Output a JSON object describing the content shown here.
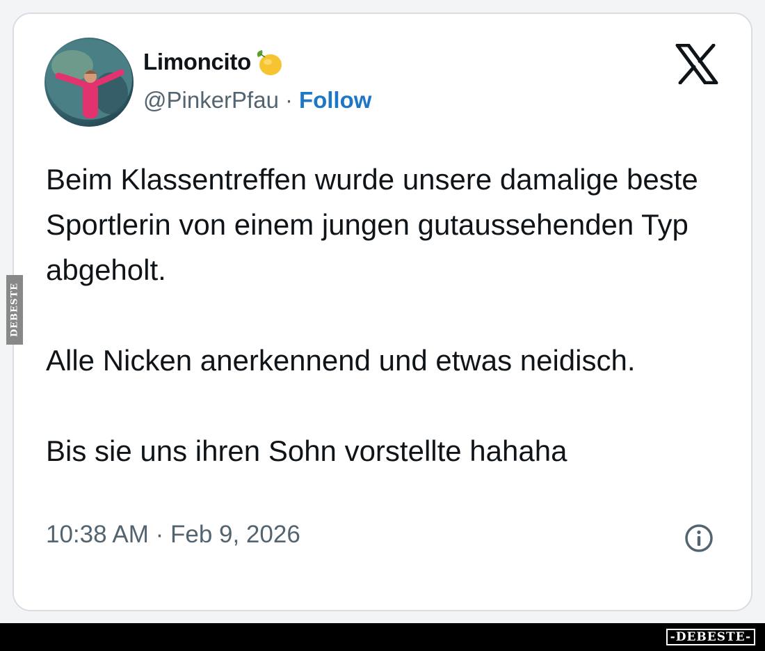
{
  "tweet": {
    "display_name": "Limoncito",
    "name_emoji": "lemon-icon",
    "handle": "@PinkerPfau",
    "separator": "·",
    "follow_label": "Follow",
    "paragraphs": [
      "Beim Klassentreffen wurde unsere damalige beste Sportlerin von einem jungen gutaussehenden Typ abgeholt.",
      "Alle Nicken anerkennend und etwas neidisch.",
      "Bis sie uns ihren Sohn vorstellte hahaha"
    ],
    "timestamp": "10:38 AM · Feb 9, 2026"
  },
  "icons": {
    "platform_logo": "x-logo-icon",
    "info": "info-icon"
  },
  "watermark": {
    "side_text": "DEBESTE",
    "footer_text": "-DEBESTE-"
  },
  "colors": {
    "text_primary": "#0f1419",
    "text_secondary": "#536471",
    "follow_link": "#1d77c6"
  }
}
